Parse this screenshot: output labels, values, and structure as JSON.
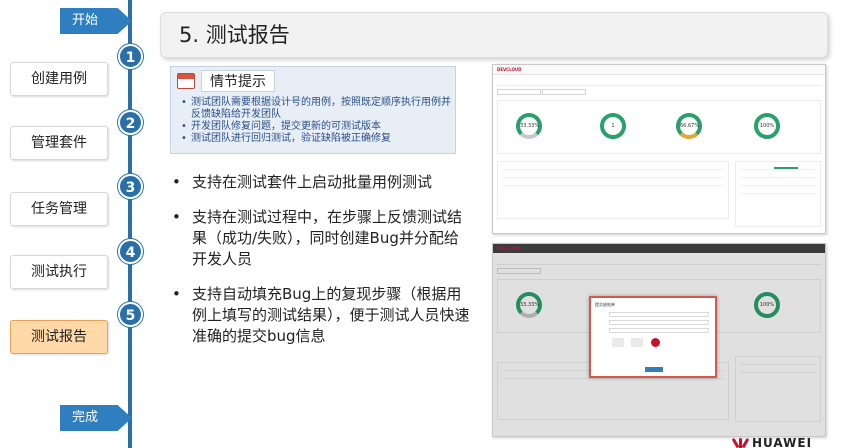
{
  "rail": {
    "start": "开始",
    "end": "完成",
    "steps": [
      {
        "num": "1",
        "label": "创建用例"
      },
      {
        "num": "2",
        "label": "管理套件"
      },
      {
        "num": "3",
        "label": "任务管理"
      },
      {
        "num": "4",
        "label": "测试执行"
      },
      {
        "num": "5",
        "label": "测试报告"
      }
    ],
    "active_step": "5"
  },
  "title": "5. 测试报告",
  "tip": {
    "title": "情节提示",
    "items": [
      "测试团队需要根据设计号的用例，按照既定顺序执行用例并反馈缺陷给开发团队",
      "开发团队修复问题，提交更新的可测试版本",
      "测试团队进行回归测试，验证缺陷被正确修复"
    ]
  },
  "bullets": [
    "支持在测试套件上启动批量用例测试",
    "支持在测试过程中，在步骤上反馈测试结果（成功/失败），同时创建Bug并分配给开发人员",
    "支持自动填充Bug上的复现步骤（根据用例上填写的测试结果），便于测试人员快速准确的提交bug信息"
  ],
  "screenshot_1": {
    "logo": "DEVCLOUD",
    "rings": [
      "33.33%",
      "1",
      "66.67%",
      "100%"
    ]
  },
  "screenshot_2": {
    "logo": "DEVCLOUD",
    "rings": [
      "33.33%",
      "100%"
    ],
    "dialog_title": "提交缺陷单"
  },
  "brand": "HUAWEI",
  "colors": {
    "rail": "#2a6fa8",
    "active_step_bg": "#ffd9a8",
    "tip_bg": "#e8eef6",
    "tip_text": "#2a4f8a",
    "brand_red": "#c8102e"
  }
}
